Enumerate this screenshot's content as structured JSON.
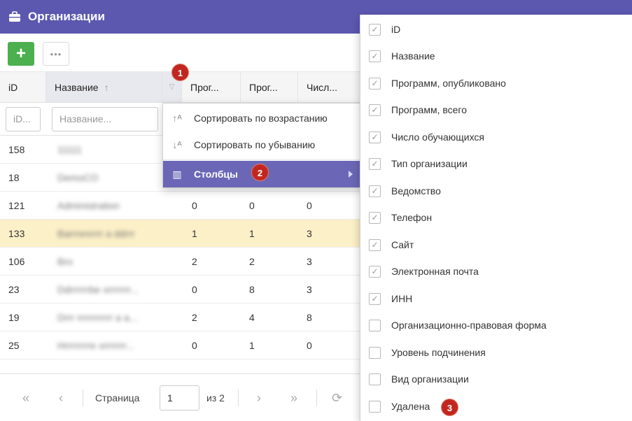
{
  "window": {
    "title": "Организации",
    "icon": "briefcase-icon"
  },
  "toolbar": {
    "add_label": "+",
    "more_label": "•••"
  },
  "grid": {
    "columns": [
      {
        "label": "iD"
      },
      {
        "label": "Название",
        "sort_icon": "↑"
      },
      {
        "label": "Прог..."
      },
      {
        "label": "Прог..."
      },
      {
        "label": "Числ..."
      }
    ],
    "filter_placeholders": {
      "id": "iD...",
      "name": "Название..."
    },
    "rows": [
      {
        "id": "158",
        "name": "11111",
        "c3": "",
        "c4": "",
        "c5": ""
      },
      {
        "id": "18",
        "name": "DemoCO",
        "c3": "",
        "c4": "",
        "c5": ""
      },
      {
        "id": "121",
        "name": "Administration",
        "c3": "0",
        "c4": "0",
        "c5": "0"
      },
      {
        "id": "133",
        "name": "Barrrenrrrr a ddrrr",
        "c3": "1",
        "c4": "1",
        "c5": "3"
      },
      {
        "id": "106",
        "name": "Bro",
        "c3": "2",
        "c4": "2",
        "c5": "3"
      },
      {
        "id": "23",
        "name": "Ddrrrrrrbe xrrrrrrr...",
        "c3": "0",
        "c4": "8",
        "c5": "3"
      },
      {
        "id": "19",
        "name": "Drrr rrrrrrrrrrr a a...",
        "c3": "2",
        "c4": "4",
        "c5": "8"
      },
      {
        "id": "25",
        "name": "Hrrrrrrrre xrrrrrrr...",
        "c3": "0",
        "c4": "1",
        "c5": "0"
      }
    ],
    "selected_row_color": "#fcf0c8"
  },
  "pager": {
    "first_icon": "«",
    "prev_icon": "‹",
    "page_label": "Страница",
    "page_value": "1",
    "of_label": "из 2",
    "next_icon": "›",
    "last_icon": "»",
    "refresh_icon": "⟳"
  },
  "context_menu": {
    "sort_asc": "Сортировать по возрастанию",
    "sort_desc": "Сортировать по убыванию",
    "columns": "Столбцы"
  },
  "badges": {
    "b1": "1",
    "b2": "2",
    "b3": "3"
  },
  "columns_menu": {
    "items": [
      {
        "label": "iD",
        "checked": true
      },
      {
        "label": "Название",
        "checked": true
      },
      {
        "label": "Программ, опубликовано",
        "checked": true
      },
      {
        "label": "Программ, всего",
        "checked": true
      },
      {
        "label": "Число обучающихся",
        "checked": true
      },
      {
        "label": "Тип организации",
        "checked": true
      },
      {
        "label": "Ведомство",
        "checked": true
      },
      {
        "label": "Телефон",
        "checked": true
      },
      {
        "label": "Сайт",
        "checked": true
      },
      {
        "label": "Электронная почта",
        "checked": true
      },
      {
        "label": "ИНН",
        "checked": true
      },
      {
        "label": "Организационно-правовая форма",
        "checked": false
      },
      {
        "label": "Уровень подчинения",
        "checked": false
      },
      {
        "label": "Вид организации",
        "checked": false
      },
      {
        "label": "Удалена",
        "checked": false
      }
    ]
  },
  "colors": {
    "header": "#5c58b0",
    "accent": "#6b67b6",
    "add_button": "#4caf50",
    "badge": "#c1271f"
  }
}
